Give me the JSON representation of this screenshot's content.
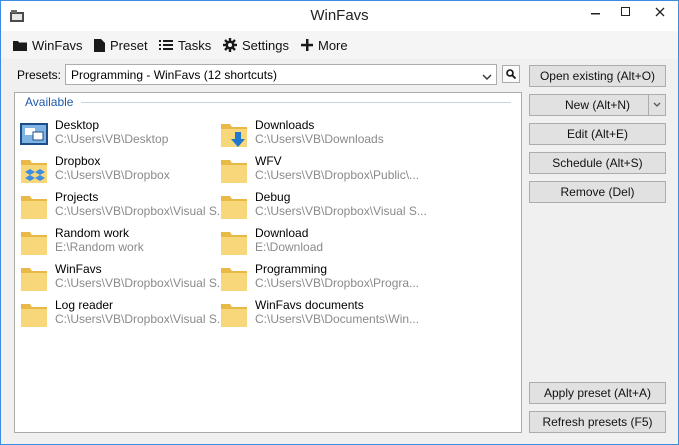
{
  "window": {
    "title": "WinFavs"
  },
  "menu": [
    {
      "label": "WinFavs",
      "icon": "folder-icon"
    },
    {
      "label": "Preset",
      "icon": "document-icon"
    },
    {
      "label": "Tasks",
      "icon": "list-icon"
    },
    {
      "label": "Settings",
      "icon": "gear-icon"
    },
    {
      "label": "More",
      "icon": "plus-icon"
    }
  ],
  "presets": {
    "label": "Presets:",
    "selected": "Programming - WinFavs (12 shortcuts)"
  },
  "group": {
    "title": "Available"
  },
  "shortcuts": [
    {
      "name": "Desktop",
      "path": "C:\\Users\\VB\\Desktop",
      "icon": "desktop-icon"
    },
    {
      "name": "Downloads",
      "path": "C:\\Users\\VB\\Downloads",
      "icon": "downloads-folder-icon"
    },
    {
      "name": "Dropbox",
      "path": "C:\\Users\\VB\\Dropbox",
      "icon": "dropbox-folder-icon"
    },
    {
      "name": "WFV",
      "path": "C:\\Users\\VB\\Dropbox\\Public\\...",
      "icon": "folder-icon"
    },
    {
      "name": "Projects",
      "path": "C:\\Users\\VB\\Dropbox\\Visual S...",
      "icon": "folder-icon"
    },
    {
      "name": "Debug",
      "path": "C:\\Users\\VB\\Dropbox\\Visual S...",
      "icon": "folder-icon"
    },
    {
      "name": "Random work",
      "path": "E:\\Random work",
      "icon": "folder-icon"
    },
    {
      "name": "Download",
      "path": "E:\\Download",
      "icon": "folder-icon"
    },
    {
      "name": "WinFavs",
      "path": "C:\\Users\\VB\\Dropbox\\Visual S...",
      "icon": "folder-icon"
    },
    {
      "name": "Programming",
      "path": "C:\\Users\\VB\\Dropbox\\Progra...",
      "icon": "folder-icon"
    },
    {
      "name": "Log reader",
      "path": "C:\\Users\\VB\\Dropbox\\Visual S...",
      "icon": "folder-icon"
    },
    {
      "name": "WinFavs documents",
      "path": "C:\\Users\\VB\\Documents\\Win...",
      "icon": "folder-icon"
    }
  ],
  "buttons": {
    "open_existing": "Open existing (Alt+O)",
    "new": "New (Alt+N)",
    "edit": "Edit (Alt+E)",
    "schedule": "Schedule (Alt+S)",
    "remove": "Remove (Del)",
    "apply_preset": "Apply preset (Alt+A)",
    "refresh_presets": "Refresh presets (F5)"
  },
  "colors": {
    "accent": "#3a8de0",
    "group_title": "#1e5ba8",
    "folder": "#f4cf6c"
  }
}
